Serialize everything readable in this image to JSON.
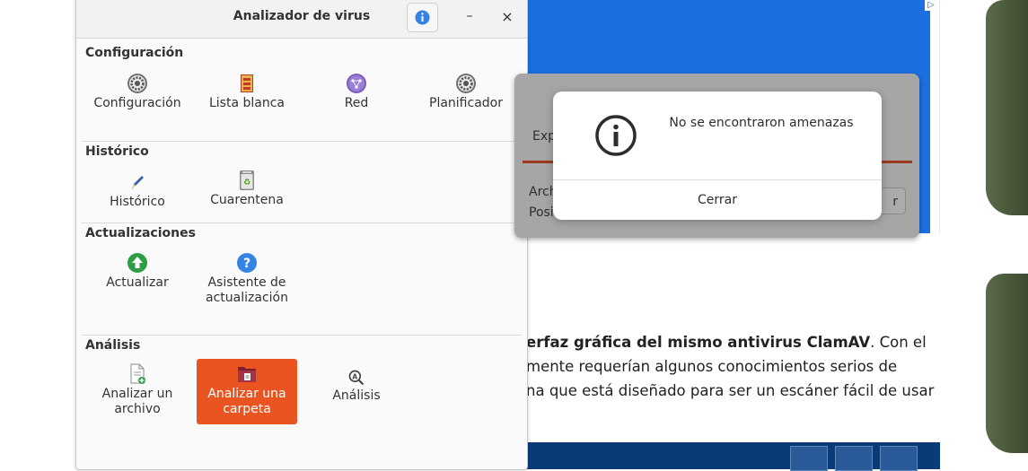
{
  "window": {
    "title": "Analizador de virus",
    "header_buttons": {
      "info": "info-icon",
      "minimize": "–",
      "close": "×"
    }
  },
  "sections": {
    "configuracion": {
      "title": "Configuración",
      "items": [
        {
          "label": "Configuración",
          "icon": "gear-icon"
        },
        {
          "label": "Lista blanca",
          "icon": "shield-list-icon"
        },
        {
          "label": "Red",
          "icon": "network-icon"
        },
        {
          "label": "Planificador",
          "icon": "scheduler-gear-icon"
        }
      ]
    },
    "historico": {
      "title": "Histórico",
      "items": [
        {
          "label": "Histórico",
          "icon": "pencil-icon"
        },
        {
          "label": "Cuarentena",
          "icon": "recycle-bin-icon"
        }
      ]
    },
    "actualizaciones": {
      "title": "Actualizaciones",
      "items": [
        {
          "label": "Actualizar",
          "icon": "update-arrow-icon"
        },
        {
          "label_line1": "Asistente de",
          "label_line2": "actualización",
          "icon": "help-icon"
        }
      ]
    },
    "analisis": {
      "title": "Análisis",
      "items": [
        {
          "label_line1": "Analizar un",
          "label_line2": "archivo",
          "icon": "file-add-icon"
        },
        {
          "label_line1": "Analizar una",
          "label_line2": "carpeta",
          "icon": "folder-icon",
          "active": true
        },
        {
          "label": "Análisis",
          "icon": "scan-search-icon"
        }
      ]
    }
  },
  "completed_dialog": {
    "tab": "Exp",
    "field1": "Arch",
    "field2": "Posi",
    "button": "r"
  },
  "message_dialog": {
    "icon": "info-circle-icon",
    "message": "No se encontraron amenazas",
    "close_label": "Cerrar"
  },
  "background_page": {
    "line1_bold": "erfaz gráfica del mismo antivirus ClamAV",
    "line1_rest": ". Con el",
    "line2": "mente requerían algunos conocimientos serios de",
    "line3": "na que está diseñado para ser un escáner fácil de usar"
  },
  "colors": {
    "accent": "#e95420",
    "ad_blue": "#1b6fe0",
    "dim_overlay": "#a6a6a6"
  }
}
